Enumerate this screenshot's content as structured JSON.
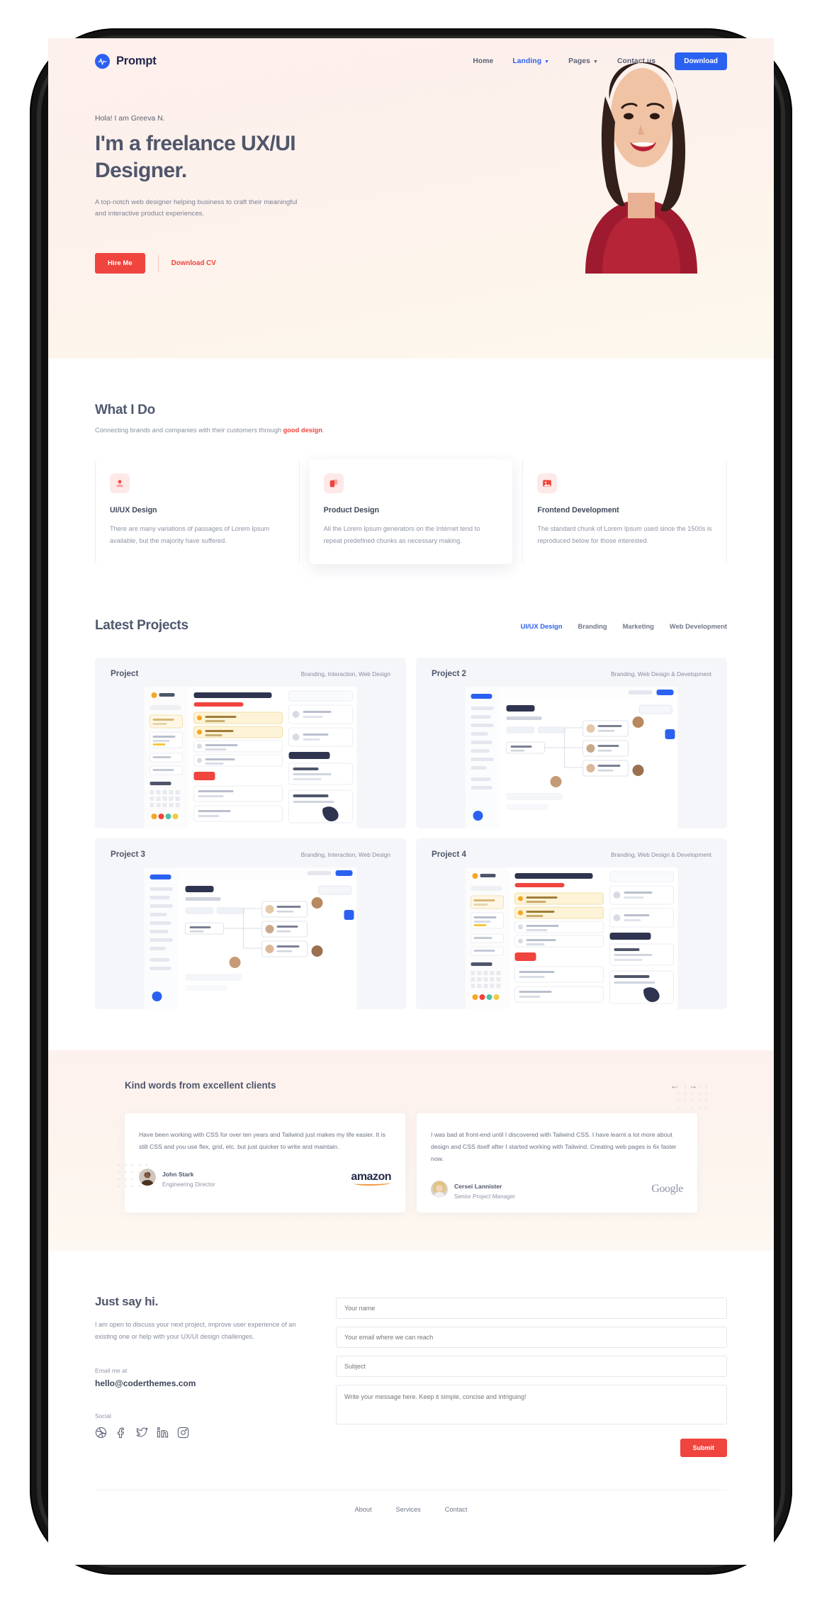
{
  "brand": {
    "name": "Prompt",
    "mark_icon": "pulse-circle-icon",
    "accent": "#2b61f0"
  },
  "nav": {
    "items": [
      {
        "label": "Home",
        "active": false,
        "caret": false
      },
      {
        "label": "Landing",
        "active": true,
        "caret": true
      },
      {
        "label": "Pages",
        "active": false,
        "caret": true
      },
      {
        "label": "Contact us",
        "active": false,
        "caret": false
      }
    ],
    "download_label": "Download"
  },
  "hero": {
    "kicker": "Hola! I am Greeva N.",
    "title": "I'm a freelance UX/UI Designer.",
    "description": "A top-notch web designer helping business to craft their meaningful and interactive product experiences.",
    "primary_label": "Hire Me",
    "secondary_label": "Download CV",
    "primary_color": "#f0443e"
  },
  "what_i_do": {
    "title": "What I Do",
    "subtitle_prefix": "Connecting brands and companies with their customers through ",
    "subtitle_highlight": "good design",
    "subtitle_suffix": ".",
    "cards": [
      {
        "icon": "user-avatar-icon",
        "title": "UI/UX Design",
        "text": "There are many variations of passages of Lorem Ipsum available, but the majority have suffered."
      },
      {
        "icon": "layers-stack-icon",
        "title": "Product Design",
        "text": "All the Lorem Ipsum generators on the Internet tend to repeat predefined chunks as necessary making."
      },
      {
        "icon": "image-picture-icon",
        "title": "Frontend Development",
        "text": "The standard chunk of Lorem Ipsum used since the 1500s is reproduced below for those interested."
      }
    ]
  },
  "projects": {
    "title": "Latest Projects",
    "filters": [
      {
        "label": "UI/UX Design",
        "active": true
      },
      {
        "label": "Branding",
        "active": false
      },
      {
        "label": "Marketing",
        "active": false
      },
      {
        "label": "Web Development",
        "active": false
      }
    ],
    "items": [
      {
        "name": "Project",
        "tags": "Branding, Interaction, Web Design",
        "shot": "schedule-dashboard"
      },
      {
        "name": "Project 2",
        "tags": "Branding, Web Design & Development",
        "shot": "people-org-chart"
      },
      {
        "name": "Project 3",
        "tags": "Branding, Interaction, Web Design",
        "shot": "people-org-chart"
      },
      {
        "name": "Project 4",
        "tags": "Branding, Web Design & Development",
        "shot": "schedule-dashboard"
      }
    ]
  },
  "testimonials": {
    "title": "Kind words from excellent clients",
    "prev_icon": "arrow-left-icon",
    "next_icon": "arrow-right-icon",
    "items": [
      {
        "text": "Have been working with CSS for over ten years and Tailwind just makes my life easier. It is still CSS and you use flex, grid, etc. but just quicker to write and maintain.",
        "name": "John Stark",
        "role": "Engineering Director",
        "logo": "amazon"
      },
      {
        "text": "I was bad at front-end until I discovered with Tailwind CSS. I have learnt a lot more about design and CSS itself after I started working with Tailwind. Creating web pages is 6x faster now.",
        "name": "Cersei Lannister",
        "role": "Senior Project Manager",
        "logo": "Google"
      }
    ]
  },
  "contact": {
    "title": "Just say hi.",
    "description": "I am open to discuss your next project, improve user experience of an existing one or help with your UX/UI design challenges.",
    "email_label": "Email me at",
    "email": "hello@coderthemes.com",
    "social_label": "Social",
    "socials": [
      {
        "icon": "dribbble-icon"
      },
      {
        "icon": "facebook-icon"
      },
      {
        "icon": "twitter-icon"
      },
      {
        "icon": "linkedin-icon"
      },
      {
        "icon": "instagram-icon"
      }
    ],
    "form": {
      "name_placeholder": "Your name",
      "email_placeholder": "Your email where we can reach",
      "subject_placeholder": "Subject",
      "message_placeholder": "Write your message here. Keep it simple, concise and intriguing!",
      "submit_label": "Submit",
      "submit_color": "#f0443e"
    }
  },
  "footer": {
    "links": [
      {
        "label": "About"
      },
      {
        "label": "Services"
      },
      {
        "label": "Contact"
      }
    ]
  }
}
